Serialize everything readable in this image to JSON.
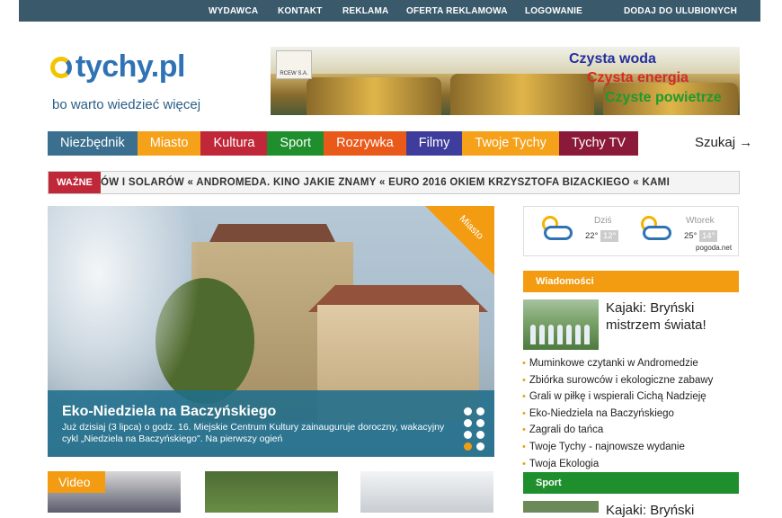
{
  "topbar": {
    "links": [
      "WYDAWCA",
      "KONTAKT",
      "REKLAMA",
      "OFERTA REKLAMOWA",
      "LOGOWANIE"
    ],
    "favorite": "DODAJ DO ULUBIONYCH"
  },
  "logo": {
    "text": "tychy.pl",
    "tagline": "bo warto wiedzieć więcej"
  },
  "banner": {
    "line1": "Czysta woda",
    "line2": "Czysta energia",
    "line3": "Czyste powietrze",
    "company": "RCEW S.A."
  },
  "nav": {
    "items": [
      {
        "label": "Niezbędnik",
        "color": "#3a6f8f"
      },
      {
        "label": "Miasto",
        "color": "#f5a11a"
      },
      {
        "label": "Kultura",
        "color": "#c0283a"
      },
      {
        "label": "Sport",
        "color": "#1f8f2e"
      },
      {
        "label": "Rozrywka",
        "color": "#e8591a"
      },
      {
        "label": "Filmy",
        "color": "#3f3d9c"
      },
      {
        "label": "Twoje Tychy",
        "color": "#f5a11a"
      },
      {
        "label": "Tychy TV",
        "color": "#8b1a3a"
      }
    ],
    "search": "Szukaj →"
  },
  "ticker": {
    "badge": "WAŻNE",
    "text": "ÓW I SOLARÓW  «  ANDROMEDA. KINO JAKIE ZNAMY  «  EURO 2016 OKIEM KRZYSZTOFA BIZACKIEGO  «  KAMI"
  },
  "hero": {
    "tag": "Miasto",
    "title": "Eko-Niedziela na Baczyńskiego",
    "text": "Już dzisiaj (3 lipca) o godz. 16. Miejskie Centrum Kultury zainauguruje doroczny, wakacyjny cykl „Niedziela na Baczyńskiego\". Na pierwszy ogień",
    "active_slide": 6
  },
  "video": {
    "label": "Video"
  },
  "weather": {
    "today_label": "Dziś",
    "today_temp": "22°",
    "today_night": "12°",
    "tuesday_label": "Wtorek",
    "tuesday_temp": "25°",
    "tuesday_night": "14°",
    "source": "pogoda.net"
  },
  "news": {
    "header": "Wiadomości",
    "header_color": "#f39c12",
    "featured_title": "Kajaki: Bryński mistrzem świata!",
    "items": [
      "Muminkowe czytanki w Andromedzie",
      "Zbiórka surowców i ekologiczne zabawy",
      "Grali w piłkę i wspierali Cichą Nadzieję",
      "Eko-Niedziela na Baczyńskiego",
      "Zagrali do tańca",
      "Twoje Tychy - najnowsze wydanie",
      "Twoja Ekologia"
    ]
  },
  "sport": {
    "header": "Sport",
    "header_color": "#1f8f2e",
    "featured_title": "Kajaki: Bryński"
  }
}
